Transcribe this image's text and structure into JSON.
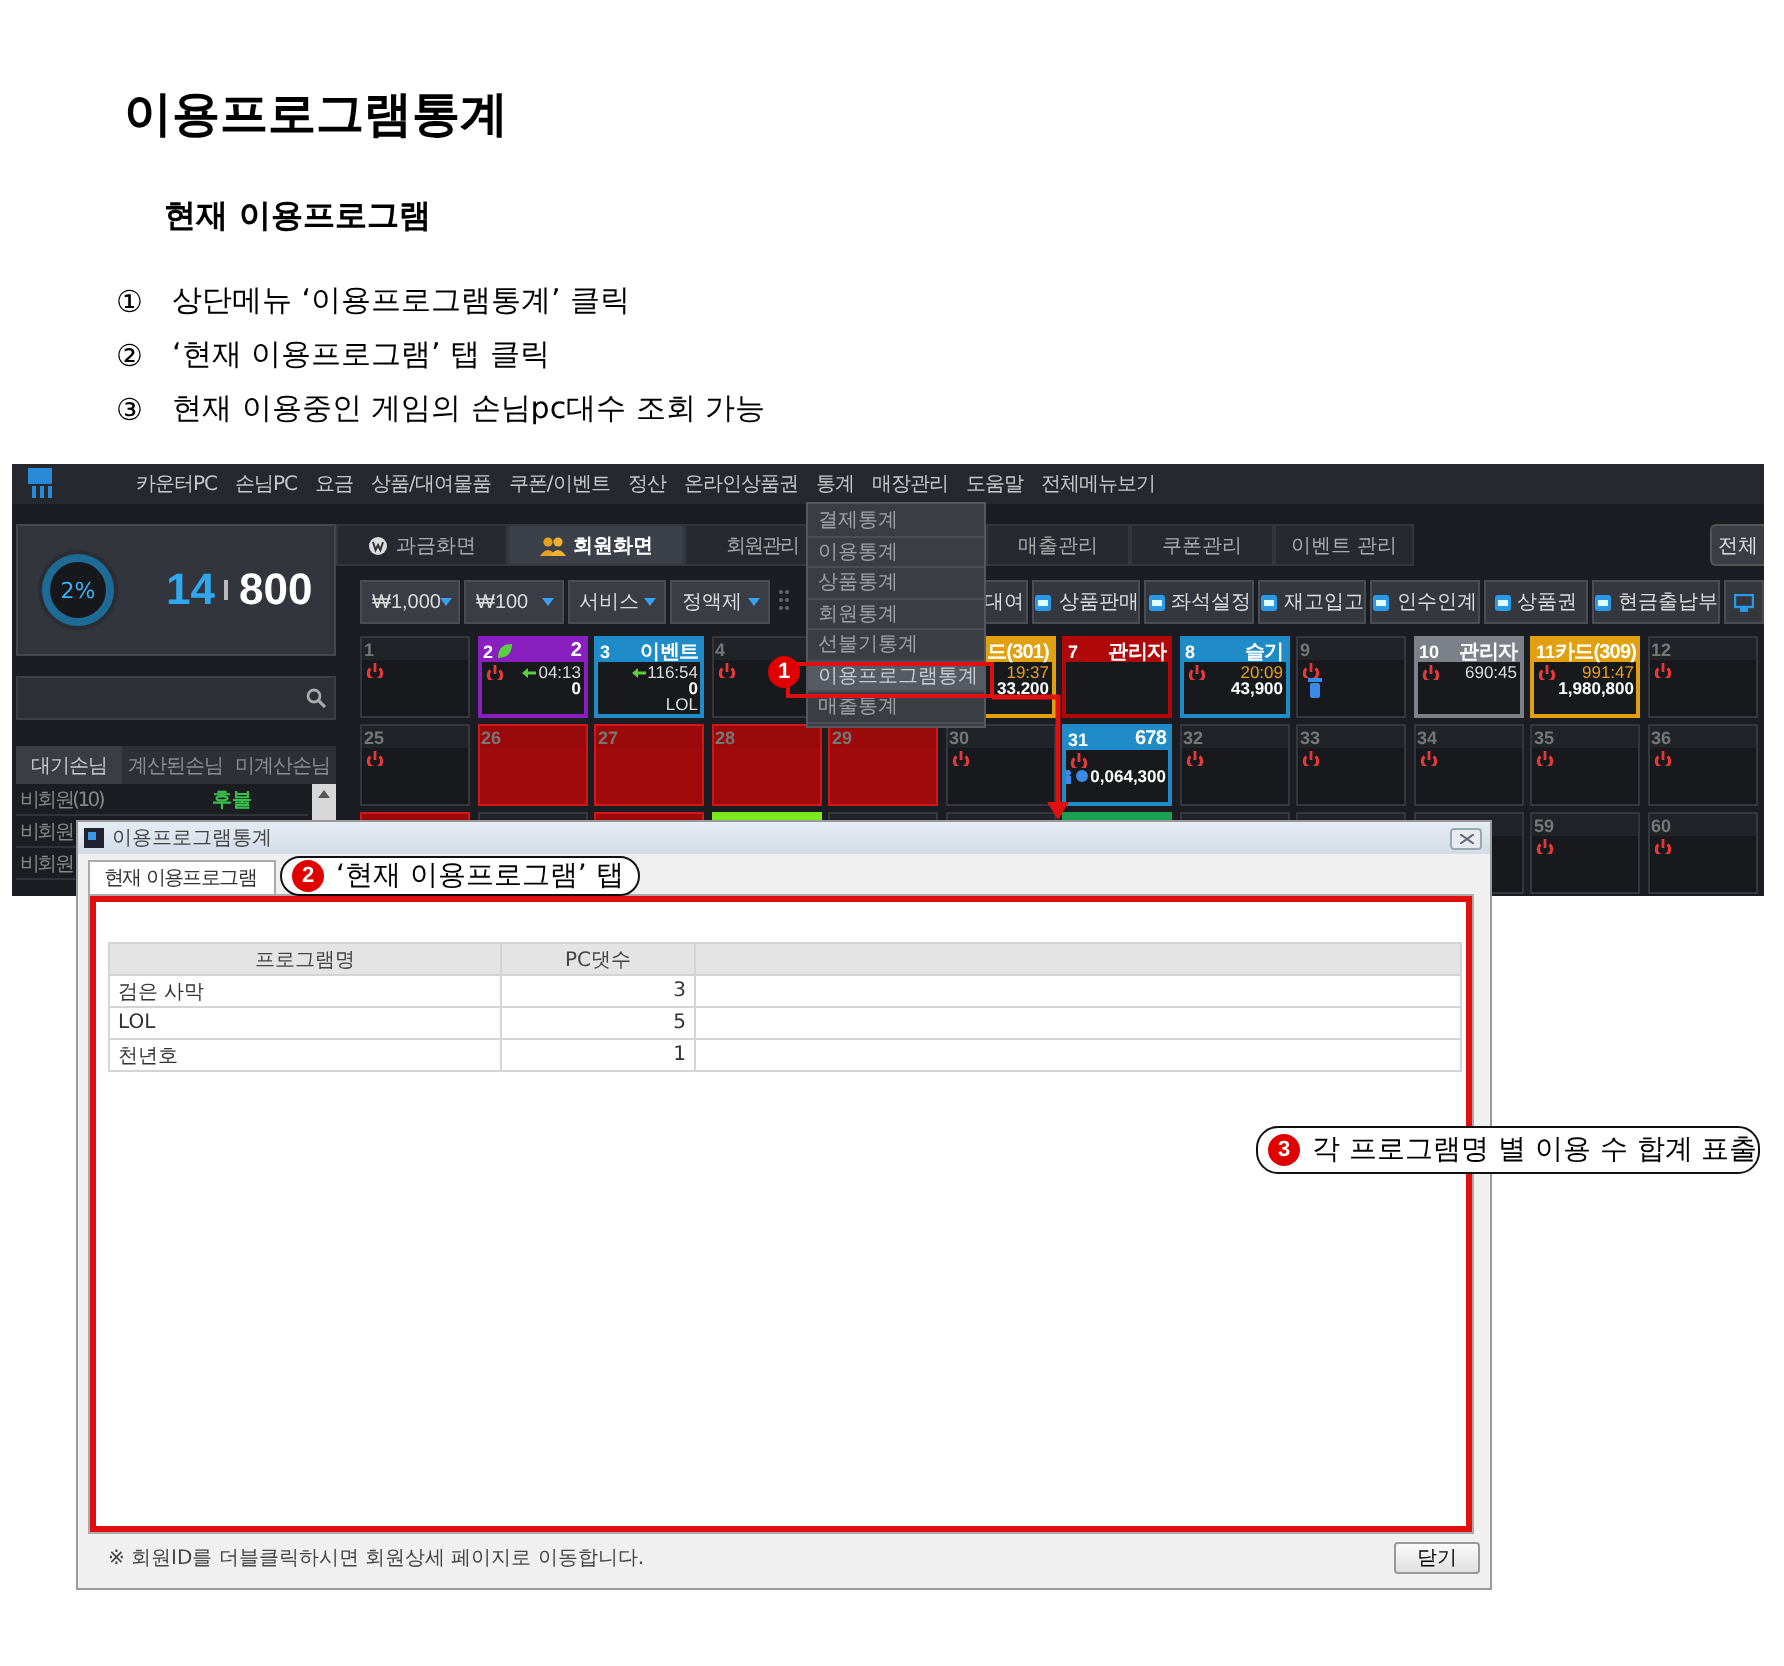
{
  "doc": {
    "title": "이용프로그램통계",
    "subtitle": "현재 이용프로그램",
    "steps": [
      {
        "marker": "①",
        "text": "상단메뉴 ‘이용프로그램통계’ 클릭"
      },
      {
        "marker": "②",
        "text": "‘현재 이용프로그램’ 탭 클릭"
      },
      {
        "marker": "③",
        "text": "현재 이용중인 게임의 손님pc대수 조회 가능"
      }
    ]
  },
  "app": {
    "menu": [
      "카운터PC",
      "손님PC",
      "요금",
      "상품/대여물품",
      "쿠폰/이벤트",
      "정산",
      "온라인상품권",
      "통계",
      "매장관리",
      "도움말",
      "전체메뉴보기"
    ],
    "stats_menu": {
      "items": [
        {
          "label": "결제통계",
          "selected": false
        },
        {
          "label": "이용통계",
          "selected": false
        },
        {
          "label": "상품통계",
          "selected": false
        },
        {
          "label": "회원통계",
          "selected": false
        },
        {
          "label": "선불기통계",
          "selected": false
        },
        {
          "label": "이용프로그램통계",
          "selected": true
        },
        {
          "label": "매출통계",
          "selected": false
        }
      ]
    },
    "gauge": {
      "percent": "2%",
      "count": "14",
      "total": "800"
    },
    "list_tabs": [
      {
        "label": "대기손님",
        "selected": true
      },
      {
        "label": "계산된손님",
        "selected": false
      },
      {
        "label": "미계산손님",
        "selected": false
      }
    ],
    "list_rows": [
      {
        "name": "비회원(10)",
        "status": "후불"
      },
      {
        "name": "비회원"
      },
      {
        "name": "비회원"
      }
    ],
    "main_tabs": [
      {
        "label": "과금화면",
        "selected": false
      },
      {
        "label": "회원화면",
        "selected": true
      },
      {
        "label": "회원관리",
        "selected": false
      },
      {
        "label": "매출관리",
        "selected": false
      },
      {
        "label": "쿠폰관리",
        "selected": false
      },
      {
        "label": "이벤트 관리",
        "selected": false
      }
    ],
    "all_button": "전체",
    "dropdowns": [
      "₩1,000",
      "₩100",
      "서비스",
      "정액제"
    ],
    "tool_buttons": [
      {
        "label": "대여"
      },
      {
        "label": "상품판매"
      },
      {
        "label": "좌석설정"
      },
      {
        "label": "재고입고"
      },
      {
        "label": "인수인계"
      },
      {
        "label": "상품권"
      },
      {
        "label": "현금출납부"
      }
    ],
    "seats": [
      {
        "kind": "off",
        "number": "1",
        "power": true
      },
      {
        "kind": "used",
        "number": "2",
        "label": "2",
        "color": "#8a1fc0",
        "leaf": true,
        "power": true,
        "arrow": true,
        "time": "04:13",
        "amount": "0"
      },
      {
        "kind": "used",
        "number": "3",
        "label": "이벤트",
        "color": "#1f8cc8",
        "arrow": true,
        "time": "116:54",
        "amount": "0",
        "game": "LOL"
      },
      {
        "kind": "off",
        "number": "4",
        "power": true
      },
      {
        "kind": "covered"
      },
      {
        "kind": "used",
        "label": "드(301)",
        "color": "#e0a010",
        "time": "19:37",
        "time_alert": true,
        "amount": "33,200"
      },
      {
        "kind": "used",
        "number": "7",
        "label": "관리자",
        "color": "#b00808"
      },
      {
        "kind": "used",
        "number": "8",
        "label": "슬기",
        "color": "#1f8cc8",
        "power": true,
        "time": "20:09",
        "time_alert": true,
        "amount": "43,900"
      },
      {
        "kind": "off",
        "number": "9",
        "power": true,
        "trash": true
      },
      {
        "kind": "used",
        "number": "10",
        "label": "관리자",
        "color": "#7c8088",
        "power": true,
        "time": "690:45"
      },
      {
        "kind": "used",
        "number": "11",
        "label": "카드(309)",
        "color": "#e0a010",
        "power": true,
        "time": "991:47",
        "time_alert": true,
        "amount": "1,980,800"
      },
      {
        "kind": "off",
        "number": "12",
        "power": true
      },
      {
        "kind": "off",
        "number": "25",
        "power": true
      },
      {
        "kind": "reserved",
        "number": "26"
      },
      {
        "kind": "reserved",
        "number": "27"
      },
      {
        "kind": "reserved",
        "number": "28"
      },
      {
        "kind": "reserved",
        "number": "29"
      },
      {
        "kind": "off",
        "number": "30",
        "power": true
      },
      {
        "kind": "used",
        "number": "31",
        "label": "678",
        "color": "#1f8cc8",
        "power": true,
        "coins": true,
        "amount": "0,064,300"
      },
      {
        "kind": "off",
        "number": "32",
        "power": true
      },
      {
        "kind": "off",
        "number": "33",
        "power": true
      },
      {
        "kind": "off",
        "number": "34",
        "power": true
      },
      {
        "kind": "off",
        "number": "35",
        "power": true
      },
      {
        "kind": "off",
        "number": "36",
        "power": true
      },
      {
        "kind": "reserved"
      },
      {
        "kind": "off"
      },
      {
        "kind": "reserved"
      },
      {
        "kind": "used",
        "color": "#7ee81f"
      },
      {
        "kind": "off"
      },
      {
        "kind": "off"
      },
      {
        "kind": "used",
        "color": "#1aa050"
      },
      {
        "kind": "off"
      },
      {
        "kind": "off"
      },
      {
        "kind": "off"
      },
      {
        "kind": "off",
        "number": "59",
        "power": true
      },
      {
        "kind": "off",
        "number": "60",
        "power": true
      }
    ]
  },
  "dialog": {
    "title": "이용프로그램통계",
    "tabs": [
      {
        "label": "현재 이용프로그램",
        "selected": true
      }
    ],
    "columns": [
      "프로그램명",
      "PC댓수"
    ],
    "rows": [
      [
        "검은 사막",
        "3"
      ],
      [
        "LOL",
        "5"
      ],
      [
        "천년호",
        "1"
      ]
    ],
    "note": "※ 회원ID를 더블클릭하시면 회원상세 페이지로 이동합니다.",
    "close_button": "닫기"
  },
  "callouts": [
    {
      "number": "1"
    },
    {
      "number": "2",
      "text": "‘현재 이용프로그램’ 탭"
    },
    {
      "number": "3",
      "text": "각 프로그램명 별 이용 수 합계 표출"
    }
  ]
}
